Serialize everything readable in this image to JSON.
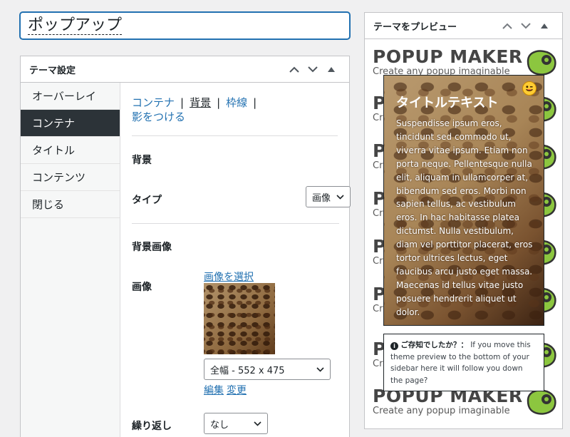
{
  "post_title": "ポップアップ",
  "settings": {
    "title": "テーマ設定",
    "tabs": [
      "オーバーレイ",
      "コンテナ",
      "タイトル",
      "コンテンツ",
      "閉じる"
    ],
    "active_tab": 1,
    "subnav": {
      "container": "コンテナ",
      "background": "背景",
      "border": "枠線",
      "shadow": "影をつける",
      "sep": "|"
    },
    "background_heading": "背景",
    "type_label": "タイプ",
    "type_value": "画像",
    "bg_image_heading": "背景画像",
    "image_label": "画像",
    "select_image_link": "画像を選択",
    "size_value": "全幅 - 552 x 475",
    "edit_link": "編集",
    "change_link": "変更",
    "repeat_label": "繰り返し",
    "repeat_value": "なし"
  },
  "preview": {
    "title": "テーマをプレビュー",
    "brand_title": "POPUP MAKER",
    "brand_partial": "P",
    "brand_partial_sub": "Cr",
    "brand_sub": "Create any popup imaginable",
    "popup_title": "タイトルテキスト",
    "popup_body": "Suspendisse ipsum eros, tincidunt sed commodo ut, viverra vitae ipsum. Etiam non porta neque. Pellentesque nulla elit, aliquam in ullamcorper at, bibendum sed eros. Morbi non sapien tellus, ac vestibulum eros. In hac habitasse platea dictumst. Nulla vestibulum, diam vel porttitor placerat, eros tortor ultrices lectus, eget faucibus arcu justo eget massa. Maecenas id tellus vitae justo posuere hendrerit aliquet ut dolor.",
    "tip_heading": "ご存知でしたか？：",
    "tip_text": "If you move this theme preview to the bottom of your sidebar here it will follow you down the page?"
  },
  "colors": {
    "accent": "#2271b1",
    "active_tab_bg": "#2c3338",
    "logo_green": "#8cc63f"
  }
}
